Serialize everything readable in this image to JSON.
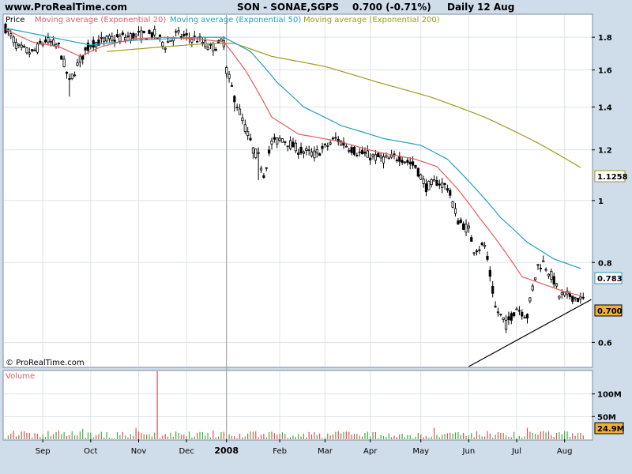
{
  "header": {
    "site": "www.ProRealTime.com",
    "symbol": "SON - SONAE,SGPS",
    "price_change": "0.700 (-0.71%)",
    "period": "Daily",
    "date": "12 Aug"
  },
  "colors": {
    "background": "#cfdcea",
    "plot_bg": "#ffffff",
    "grid": "#dde3ea",
    "candle": "#000000",
    "ema20": "#e06060",
    "ema50": "#20a0c0",
    "ema200": "#a09a18",
    "volume_up": "#3cb03c",
    "volume_down": "#e05050",
    "vertical_marker": "#999999",
    "trendline": "#000000"
  },
  "chart_data": {
    "type": "line",
    "price_panel": {
      "legend": {
        "price": "Price",
        "ema20": "Moving average (Exponential 20)",
        "ema50": "Moving average (Exponential 50)",
        "ema200": "Moving average (Exponential 200)"
      },
      "y_scale": "log",
      "ylim": [
        0.55,
        1.95
      ],
      "y_ticks": [
        0.6,
        0.8,
        1,
        1.2,
        1.4,
        1.6,
        1.8
      ],
      "y_tick_labels": [
        "0.6",
        "0.8",
        "1",
        "1.2",
        "1.4",
        "1.6",
        "1.8"
      ],
      "value_tags": {
        "ema200": "1.1258",
        "ema50": "0.783",
        "price": "0.700"
      },
      "watermark": "© ProRealTime.com",
      "series": {
        "price_knots": [
          [
            0,
            1.86
          ],
          [
            5,
            1.73
          ],
          [
            10,
            1.7
          ],
          [
            15,
            1.78
          ],
          [
            20,
            1.74
          ],
          [
            24,
            1.53
          ],
          [
            28,
            1.66
          ],
          [
            32,
            1.76
          ],
          [
            40,
            1.79
          ],
          [
            48,
            1.81
          ],
          [
            56,
            1.82
          ],
          [
            60,
            1.75
          ],
          [
            64,
            1.82
          ],
          [
            68,
            1.8
          ],
          [
            72,
            1.79
          ],
          [
            77,
            1.73
          ],
          [
            82,
            1.77
          ],
          [
            83,
            1.6
          ],
          [
            86,
            1.45
          ],
          [
            90,
            1.3
          ],
          [
            93,
            1.2
          ],
          [
            95,
            1.17
          ],
          [
            97,
            1.1
          ],
          [
            100,
            1.23
          ],
          [
            104,
            1.25
          ],
          [
            110,
            1.2
          ],
          [
            116,
            1.18
          ],
          [
            120,
            1.21
          ],
          [
            124,
            1.25
          ],
          [
            128,
            1.22
          ],
          [
            132,
            1.19
          ],
          [
            138,
            1.17
          ],
          [
            144,
            1.16
          ],
          [
            148,
            1.17
          ],
          [
            154,
            1.13
          ],
          [
            158,
            1.05
          ],
          [
            162,
            1.07
          ],
          [
            166,
            1.05
          ],
          [
            170,
            0.93
          ],
          [
            174,
            0.9
          ],
          [
            176,
            0.84
          ],
          [
            180,
            0.85
          ],
          [
            184,
            0.68
          ],
          [
            188,
            0.64
          ],
          [
            192,
            0.68
          ],
          [
            196,
            0.66
          ],
          [
            198,
            0.73
          ],
          [
            200,
            0.79
          ],
          [
            202,
            0.8
          ],
          [
            206,
            0.75
          ],
          [
            208,
            0.71
          ],
          [
            212,
            0.71
          ],
          [
            216,
            0.7
          ]
        ],
        "ema20": [
          [
            0,
            1.85
          ],
          [
            10,
            1.77
          ],
          [
            20,
            1.74
          ],
          [
            28,
            1.68
          ],
          [
            36,
            1.74
          ],
          [
            48,
            1.79
          ],
          [
            60,
            1.8
          ],
          [
            72,
            1.79
          ],
          [
            82,
            1.77
          ],
          [
            90,
            1.6
          ],
          [
            100,
            1.35
          ],
          [
            110,
            1.27
          ],
          [
            124,
            1.24
          ],
          [
            140,
            1.19
          ],
          [
            154,
            1.16
          ],
          [
            162,
            1.13
          ],
          [
            170,
            1.04
          ],
          [
            178,
            0.94
          ],
          [
            186,
            0.85
          ],
          [
            194,
            0.76
          ],
          [
            202,
            0.74
          ],
          [
            210,
            0.72
          ],
          [
            216,
            0.71
          ]
        ],
        "ema50": [
          [
            0,
            1.86
          ],
          [
            20,
            1.79
          ],
          [
            32,
            1.75
          ],
          [
            48,
            1.78
          ],
          [
            60,
            1.79
          ],
          [
            72,
            1.8
          ],
          [
            82,
            1.8
          ],
          [
            92,
            1.71
          ],
          [
            102,
            1.53
          ],
          [
            112,
            1.4
          ],
          [
            126,
            1.31
          ],
          [
            142,
            1.25
          ],
          [
            156,
            1.22
          ],
          [
            166,
            1.16
          ],
          [
            176,
            1.05
          ],
          [
            186,
            0.94
          ],
          [
            196,
            0.86
          ],
          [
            206,
            0.81
          ],
          [
            216,
            0.783
          ]
        ],
        "ema200": [
          [
            38,
            1.71
          ],
          [
            60,
            1.74
          ],
          [
            76,
            1.76
          ],
          [
            86,
            1.76
          ],
          [
            100,
            1.68
          ],
          [
            120,
            1.62
          ],
          [
            140,
            1.53
          ],
          [
            160,
            1.45
          ],
          [
            180,
            1.35
          ],
          [
            200,
            1.23
          ],
          [
            216,
            1.1258
          ]
        ],
        "trendline": [
          [
            174,
            0.55
          ],
          [
            220,
            0.7
          ]
        ]
      }
    },
    "volume_panel": {
      "title": "Volume",
      "ylim": [
        0,
        150
      ],
      "y_ticks": [
        50,
        100
      ],
      "y_tick_labels": [
        "50M",
        "100M"
      ],
      "value_tag": "24.9M",
      "spike": {
        "bar": 57,
        "value": 150
      }
    },
    "x_axis": {
      "labels": [
        "Sep",
        "Oct",
        "Nov",
        "Dec",
        "2008",
        "Feb",
        "Mar",
        "Apr",
        "May",
        "Jun",
        "Jul",
        "Aug"
      ],
      "label_bar": [
        14,
        32,
        50,
        68,
        83,
        103,
        120,
        137,
        156,
        174,
        192,
        210
      ],
      "n_bars": 220,
      "marker_bar": 83
    }
  }
}
